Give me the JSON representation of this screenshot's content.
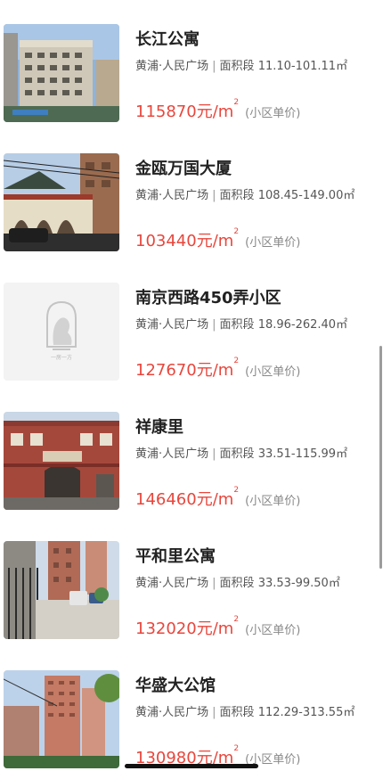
{
  "listings": [
    {
      "name": "长江公寓",
      "district": "黄浦·人民广场",
      "area_label": "面积段",
      "area_range": "11.10-101.11",
      "area_unit": "㎡",
      "price": "115870元/m",
      "price_sup": "2",
      "price_note": "(小区单价)",
      "image_icon": "building-photo"
    },
    {
      "name": "金瓯万国大厦",
      "district": "黄浦·人民广场",
      "area_label": "面积段",
      "area_range": "108.45-149.00",
      "area_unit": "㎡",
      "price": "103440元/m",
      "price_sup": "2",
      "price_note": "(小区单价)",
      "image_icon": "building-photo"
    },
    {
      "name": "南京西路450弄小区",
      "district": "黄浦·人民广场",
      "area_label": "面积段",
      "area_range": "18.96-262.40",
      "area_unit": "㎡",
      "price": "127670元/m",
      "price_sup": "2",
      "price_note": "(小区单价)",
      "image_icon": "placeholder-logo",
      "placeholder_text": "一房一方"
    },
    {
      "name": "祥康里",
      "district": "黄浦·人民广场",
      "area_label": "面积段",
      "area_range": "33.51-115.99",
      "area_unit": "㎡",
      "price": "146460元/m",
      "price_sup": "2",
      "price_note": "(小区单价)",
      "image_icon": "building-photo"
    },
    {
      "name": "平和里公寓",
      "district": "黄浦·人民广场",
      "area_label": "面积段",
      "area_range": "33.53-99.50",
      "area_unit": "㎡",
      "price": "132020元/m",
      "price_sup": "2",
      "price_note": "(小区单价)",
      "image_icon": "building-photo"
    },
    {
      "name": "华盛大公馆",
      "district": "黄浦·人民广场",
      "area_label": "面积段",
      "area_range": "112.29-313.55",
      "area_unit": "㎡",
      "price": "130980元/m",
      "price_sup": "2",
      "price_note": "(小区单价)",
      "image_icon": "building-photo"
    }
  ],
  "colors": {
    "price": "#e8463c",
    "title": "#222222",
    "meta": "#555555",
    "note": "#888888"
  }
}
